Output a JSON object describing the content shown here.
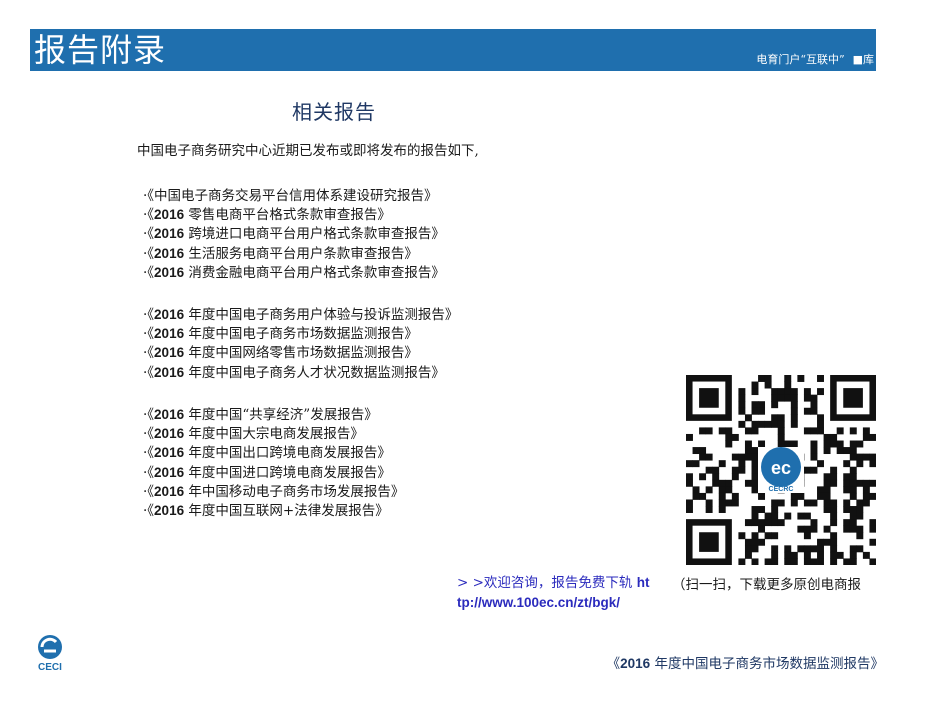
{
  "header": {
    "title": "报告附录",
    "subtitle": "电育门户“互联中”",
    "subtitle_tail": "■库"
  },
  "section_title": "相关报告",
  "intro": "中国电子商务研究中心近期已发布或即将发布的报告如下,",
  "groups": [
    [
      {
        "bullet": "·《",
        "num": "",
        "text": "中国电子商务交易平台信用体系建设研究报告》"
      },
      {
        "bullet": "·《",
        "num": "2016",
        "text": "零售电商平台格式条款审查报告》"
      },
      {
        "bullet": "·《",
        "num": "2016",
        "text": "跨境进口电商平台用户格式条款审查报告》"
      },
      {
        "bullet": "·《",
        "num": "2016",
        "text": "生活服务电商平台用户条款审查报告》"
      },
      {
        "bullet": "·《",
        "num": "2016",
        "text": "消费金融电商平台用户格式条款审查报告》"
      }
    ],
    [
      {
        "bullet": "·《",
        "num": "2016",
        "text": "年度中国电子商务用户体验与投诉监测报告》"
      },
      {
        "bullet": "·《",
        "num": "2016",
        "text": "年度中国电子商务市场数据监测报告》"
      },
      {
        "bullet": "·《",
        "num": "2016",
        "text": "年度中国网络零售市场数据监测报告》"
      },
      {
        "bullet": "·《",
        "num": "2016",
        "text": "年度中国电子商务人才状况数据监测报告》"
      }
    ],
    [
      {
        "bullet": "·《",
        "num": "2016",
        "text": "年度中国“共享经济”发展报告》"
      },
      {
        "bullet": "·《",
        "num": "2016",
        "text": "年度中国大宗电商发展报告》"
      },
      {
        "bullet": "·《",
        "num": "2016",
        "text": "年度中国出口跨境电商发展报告》"
      },
      {
        "bullet": "·《",
        "num": "2016",
        "text": "年度中国进口跨境电商发展报告》"
      },
      {
        "bullet": "·《",
        "num": "2016",
        "text": "年中国移动电子商务市场发展报告》"
      },
      {
        "bullet": "·《",
        "num": "2016",
        "text": "年度中国互联网+法律发展报告》"
      }
    ]
  ],
  "consult": {
    "lead": "> >欢迎咨询，报告免费下轨",
    "url": "http://www.100ec.cn/zt/bgk/"
  },
  "scan_text": "（扫一扫，下载更多原创电商报",
  "qr_badge": {
    "logo": "ec",
    "label": "CECRC"
  },
  "footer": {
    "lead": "《",
    "num": "2016",
    "text": "年度中国电子商务市场数据监测报告》"
  },
  "logo": {
    "label": "CECI"
  },
  "colors": {
    "header_bg": "#1f6fae",
    "title": "#1f3864",
    "link": "#2b2bbd"
  }
}
